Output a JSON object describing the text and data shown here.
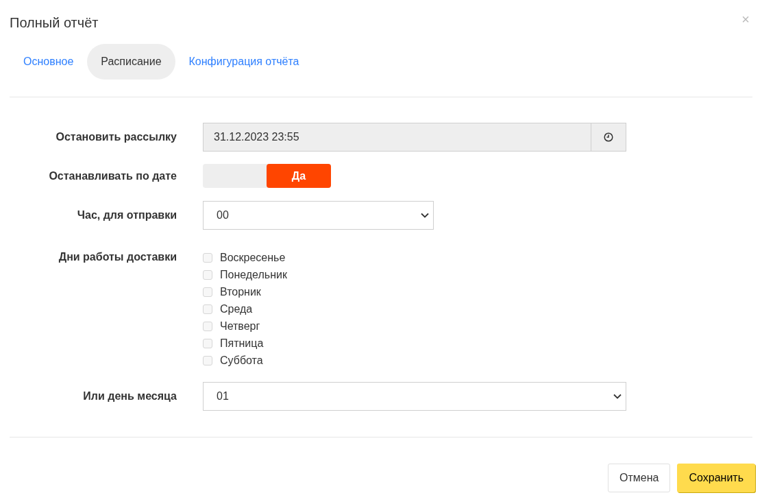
{
  "dialog": {
    "title": "Полный отчёт",
    "close": "×"
  },
  "tabs": [
    {
      "label": "Основное",
      "selected": false
    },
    {
      "label": "Расписание",
      "selected": true
    },
    {
      "label": "Конфигурация отчёта",
      "selected": false
    }
  ],
  "form": {
    "stop_mailing": {
      "label": "Остановить рассылку",
      "value": "31.12.2023 23:55"
    },
    "stop_by_date": {
      "label": "Останавливать по дате",
      "toggle_label": "Да",
      "on": true
    },
    "send_hour": {
      "label": "Час, для отправки",
      "value": "00"
    },
    "delivery_days": {
      "label": "Дни работы доставки",
      "days": [
        {
          "label": "Воскресенье",
          "checked": false
        },
        {
          "label": "Понедельник",
          "checked": false
        },
        {
          "label": "Вторник",
          "checked": false
        },
        {
          "label": "Среда",
          "checked": false
        },
        {
          "label": "Четверг",
          "checked": false
        },
        {
          "label": "Пятница",
          "checked": false
        },
        {
          "label": "Суббота",
          "checked": false
        }
      ]
    },
    "month_day": {
      "label": "Или день месяца",
      "value": "01"
    }
  },
  "buttons": {
    "cancel": "Отмена",
    "save": "Сохранить"
  }
}
